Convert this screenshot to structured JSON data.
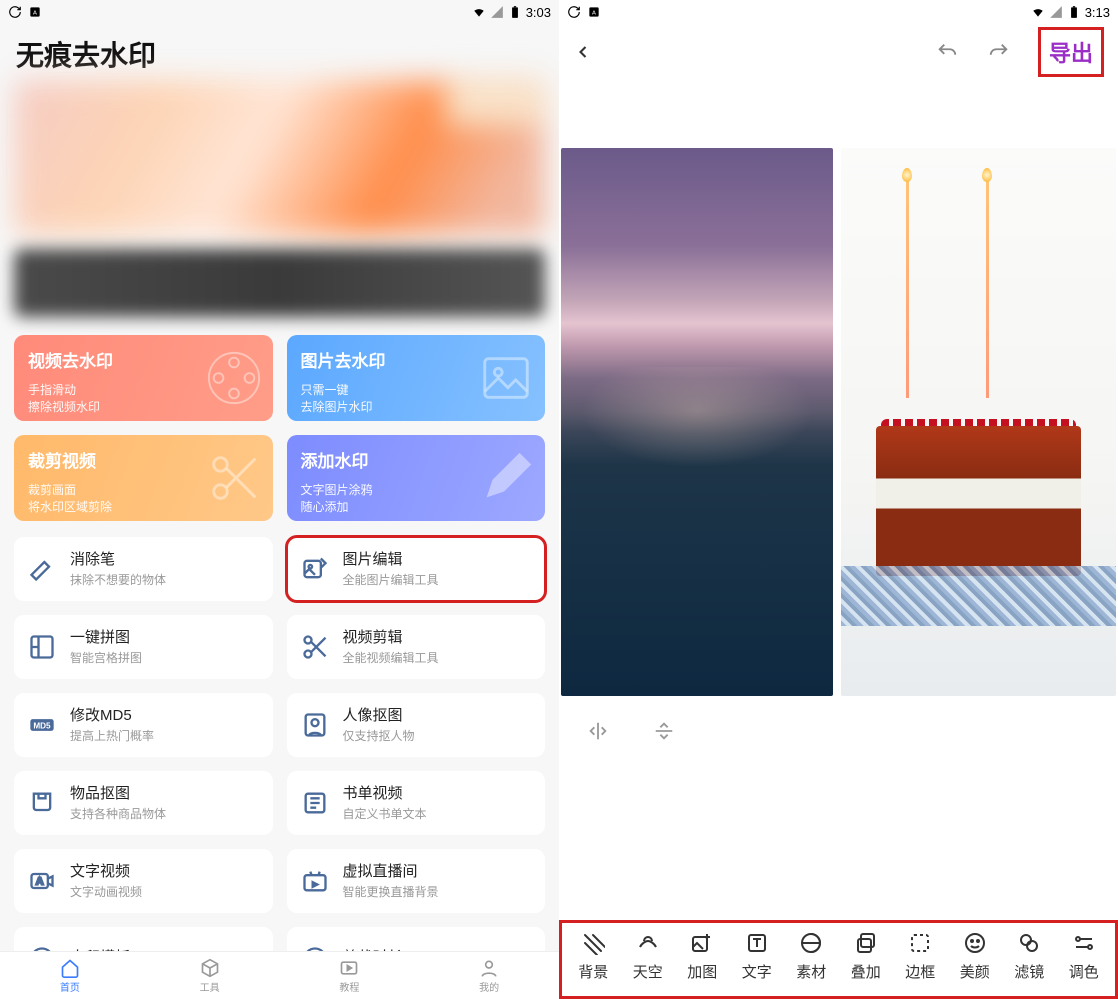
{
  "left": {
    "status_time": "3:03",
    "title": "无痕去水印",
    "big_cards": [
      {
        "title": "视频去水印",
        "sub1": "手指滑动",
        "sub2": "擦除视频水印"
      },
      {
        "title": "图片去水印",
        "sub1": "只需一键",
        "sub2": "去除图片水印"
      },
      {
        "title": "裁剪视频",
        "sub1": "裁剪画面",
        "sub2": "将水印区域剪除"
      },
      {
        "title": "添加水印",
        "sub1": "文字图片涂鸦",
        "sub2": "随心添加"
      }
    ],
    "small_cards": [
      {
        "title": "消除笔",
        "sub": "抹除不想要的物体"
      },
      {
        "title": "图片编辑",
        "sub": "全能图片编辑工具",
        "highlight": true
      },
      {
        "title": "一键拼图",
        "sub": "智能宫格拼图"
      },
      {
        "title": "视频剪辑",
        "sub": "全能视频编辑工具"
      },
      {
        "title": "修改MD5",
        "sub": "提高上热门概率"
      },
      {
        "title": "人像抠图",
        "sub": "仅支持抠人物"
      },
      {
        "title": "物品抠图",
        "sub": "支持各种商品物体"
      },
      {
        "title": "书单视频",
        "sub": "自定义书单文本"
      },
      {
        "title": "文字视频",
        "sub": "文字动画视频"
      },
      {
        "title": "虚拟直播间",
        "sub": "智能更换直播背景"
      },
      {
        "title": "水印模板",
        "sub": ""
      },
      {
        "title": "剪裁时长",
        "sub": ""
      }
    ],
    "nav": [
      {
        "label": "首页"
      },
      {
        "label": "工具"
      },
      {
        "label": "教程"
      },
      {
        "label": "我的"
      }
    ]
  },
  "right": {
    "status_time": "3:13",
    "export_label": "导出",
    "tools": [
      {
        "label": "背景"
      },
      {
        "label": "天空"
      },
      {
        "label": "加图"
      },
      {
        "label": "文字"
      },
      {
        "label": "素材"
      },
      {
        "label": "叠加"
      },
      {
        "label": "边框"
      },
      {
        "label": "美颜"
      },
      {
        "label": "滤镜"
      },
      {
        "label": "调色"
      }
    ]
  }
}
